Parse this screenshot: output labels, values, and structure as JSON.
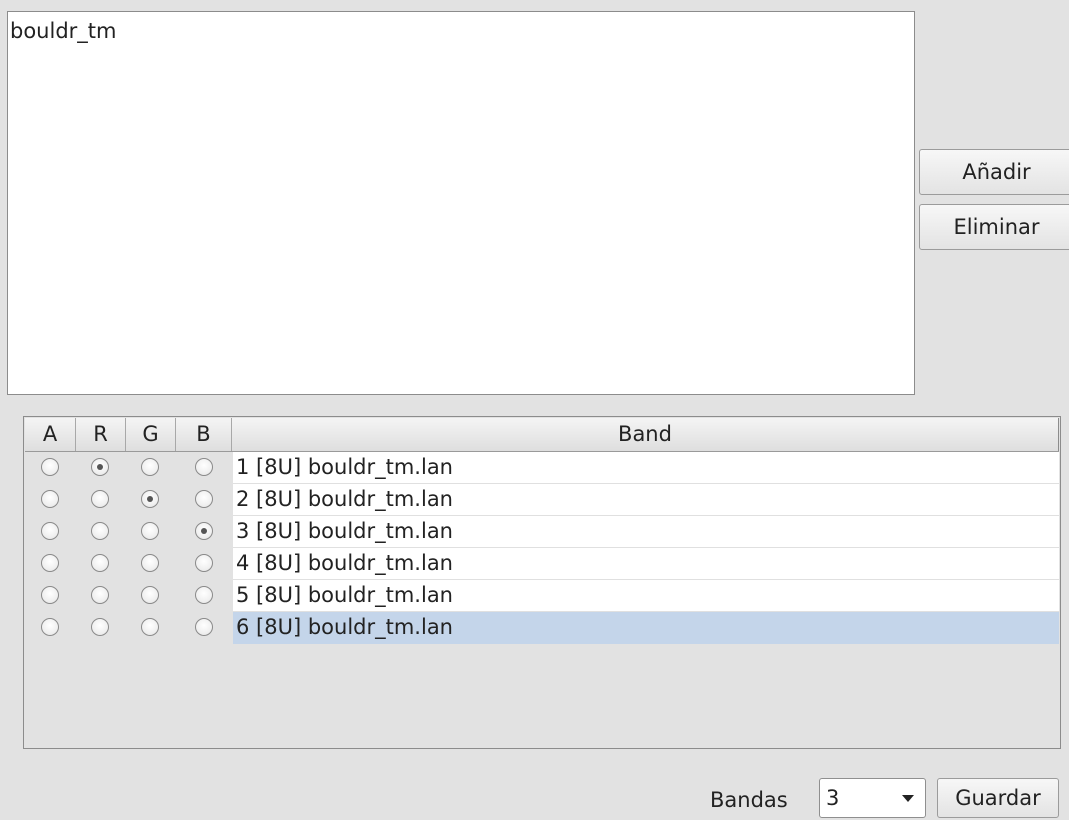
{
  "layers": {
    "items": [
      "bouldr_tm"
    ]
  },
  "actions": {
    "add_label": "Añadir",
    "remove_label": "Eliminar"
  },
  "band_table": {
    "headers": {
      "a": "A",
      "r": "R",
      "g": "G",
      "b": "B",
      "band": "Band"
    },
    "rows": [
      {
        "label": "1 [8U] bouldr_tm.lan",
        "a": false,
        "r": true,
        "g": false,
        "b": false,
        "selected": false
      },
      {
        "label": "2 [8U] bouldr_tm.lan",
        "a": false,
        "r": false,
        "g": true,
        "b": false,
        "selected": false
      },
      {
        "label": "3 [8U] bouldr_tm.lan",
        "a": false,
        "r": false,
        "g": false,
        "b": true,
        "selected": false
      },
      {
        "label": "4 [8U] bouldr_tm.lan",
        "a": false,
        "r": false,
        "g": false,
        "b": false,
        "selected": false
      },
      {
        "label": "5 [8U] bouldr_tm.lan",
        "a": false,
        "r": false,
        "g": false,
        "b": false,
        "selected": false
      },
      {
        "label": "6 [8U] bouldr_tm.lan",
        "a": false,
        "r": false,
        "g": false,
        "b": false,
        "selected": true
      }
    ]
  },
  "footer": {
    "bands_label": "Bandas",
    "bands_value": "3",
    "save_label": "Guardar"
  },
  "colors": {
    "selection": "#c4d5ea",
    "background": "#e2e2e2"
  }
}
